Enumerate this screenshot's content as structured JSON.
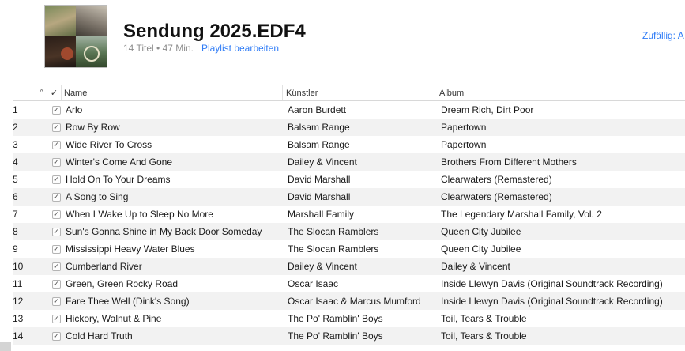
{
  "playlist": {
    "title": "Sendung 2025.EDF4",
    "track_count": "14 Titel",
    "separator": "•",
    "duration": "47 Min.",
    "edit_label": "Playlist bearbeiten",
    "shuffle_label": "Zufällig: A"
  },
  "columns": {
    "sort_icon": "^",
    "check_icon": "✓",
    "name": "Name",
    "artist": "Künstler",
    "album": "Album"
  },
  "tracks": [
    {
      "num": "1",
      "name": "Arlo",
      "artist": "Aaron Burdett",
      "album": "Dream Rich, Dirt Poor"
    },
    {
      "num": "2",
      "name": "Row By Row",
      "artist": "Balsam Range",
      "album": "Papertown"
    },
    {
      "num": "3",
      "name": "Wide River To Cross",
      "artist": "Balsam Range",
      "album": "Papertown"
    },
    {
      "num": "4",
      "name": "Winter's Come And Gone",
      "artist": "Dailey & Vincent",
      "album": "Brothers From Different Mothers"
    },
    {
      "num": "5",
      "name": "Hold On To Your Dreams",
      "artist": "David Marshall",
      "album": "Clearwaters (Remastered)"
    },
    {
      "num": "6",
      "name": "A Song to Sing",
      "artist": "David Marshall",
      "album": "Clearwaters (Remastered)"
    },
    {
      "num": "7",
      "name": "When I Wake Up to Sleep No More",
      "artist": "Marshall Family",
      "album": "The Legendary Marshall Family, Vol. 2"
    },
    {
      "num": "8",
      "name": "Sun's Gonna Shine in My Back Door Someday",
      "artist": "The Slocan Ramblers",
      "album": "Queen City Jubilee"
    },
    {
      "num": "9",
      "name": "Mississippi Heavy Water Blues",
      "artist": "The Slocan Ramblers",
      "album": "Queen City Jubilee"
    },
    {
      "num": "10",
      "name": "Cumberland River",
      "artist": "Dailey & Vincent",
      "album": "Dailey & Vincent"
    },
    {
      "num": "11",
      "name": "Green, Green Rocky Road",
      "artist": "Oscar Isaac",
      "album": "Inside Llewyn Davis (Original Soundtrack Recording)"
    },
    {
      "num": "12",
      "name": "Fare Thee Well (Dink's Song)",
      "artist": "Oscar Isaac & Marcus Mumford",
      "album": "Inside Llewyn Davis (Original Soundtrack Recording)"
    },
    {
      "num": "13",
      "name": "Hickory, Walnut & Pine",
      "artist": "The Po' Ramblin' Boys",
      "album": "Toil, Tears & Trouble"
    },
    {
      "num": "14",
      "name": "Cold Hard Truth",
      "artist": "The Po' Ramblin' Boys",
      "album": "Toil, Tears & Trouble"
    }
  ],
  "checkbox_glyph": "✓",
  "colors": {
    "accent": "#2f7cf6",
    "row_alt": "#f2f2f2"
  }
}
